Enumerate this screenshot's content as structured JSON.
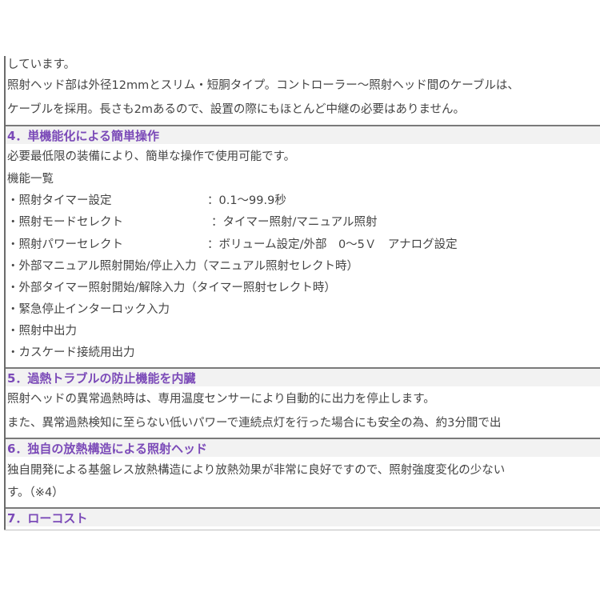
{
  "clipped_top": "しています。",
  "intro_lines": [
    "照射ヘッド部は外径12mmとスリム・短胴タイプ。コントローラー〜照射ヘッド間のケーブルは、",
    "ケーブルを採用。長さも2mあるので、設置の際にもほとんど中継の必要はありません。"
  ],
  "sections": [
    {
      "heading": "4．単機能化による簡単操作",
      "lines": [
        "必要最低限の装備により、簡単な操作で使用可能です。",
        "機能一覧"
      ],
      "features": [
        {
          "name": "・照射タイマー設定",
          "value": "：0.1〜99.9秒"
        },
        {
          "name": "・照射モードセレクト",
          "value": "：タイマー照射/マニュアル照射"
        },
        {
          "name": "・照射パワーセレクト",
          "value": "：ボリューム設定/外部　0〜5Ｖ　アナログ設定"
        },
        {
          "name": "・外部マニュアル照射開始/停止入力（マニュアル照射セレクト時）",
          "value": ""
        },
        {
          "name": "・外部タイマー照射開始/解除入力（タイマー照射セレクト時）",
          "value": ""
        },
        {
          "name": "・緊急停止インターロック入力",
          "value": ""
        },
        {
          "name": "・照射中出力",
          "value": ""
        },
        {
          "name": "・カスケード接続用出力",
          "value": ""
        }
      ]
    },
    {
      "heading": "5．過熱トラブルの防止機能を内臓",
      "lines": [
        "照射ヘッドの異常過熱時は、専用温度センサーにより自動的に出力を停止します。",
        "また、異常過熱検知に至らない低いパワーで連続点灯を行った場合にも安全の為、約3分間で出"
      ]
    },
    {
      "heading": "6．独自の放熱構造による照射ヘッド",
      "lines": [
        "独自開発による基盤レス放熱構造により放熱効果が非常に良好ですので、照射強度変化の少ない",
        "す。（※4）"
      ]
    },
    {
      "heading": "7．ローコスト",
      "lines": []
    }
  ],
  "colors": {
    "heading_text": "#7b4ab8",
    "heading_bg": "#f2f2f2",
    "body_text": "#444444",
    "border": "#7a7a7a"
  }
}
